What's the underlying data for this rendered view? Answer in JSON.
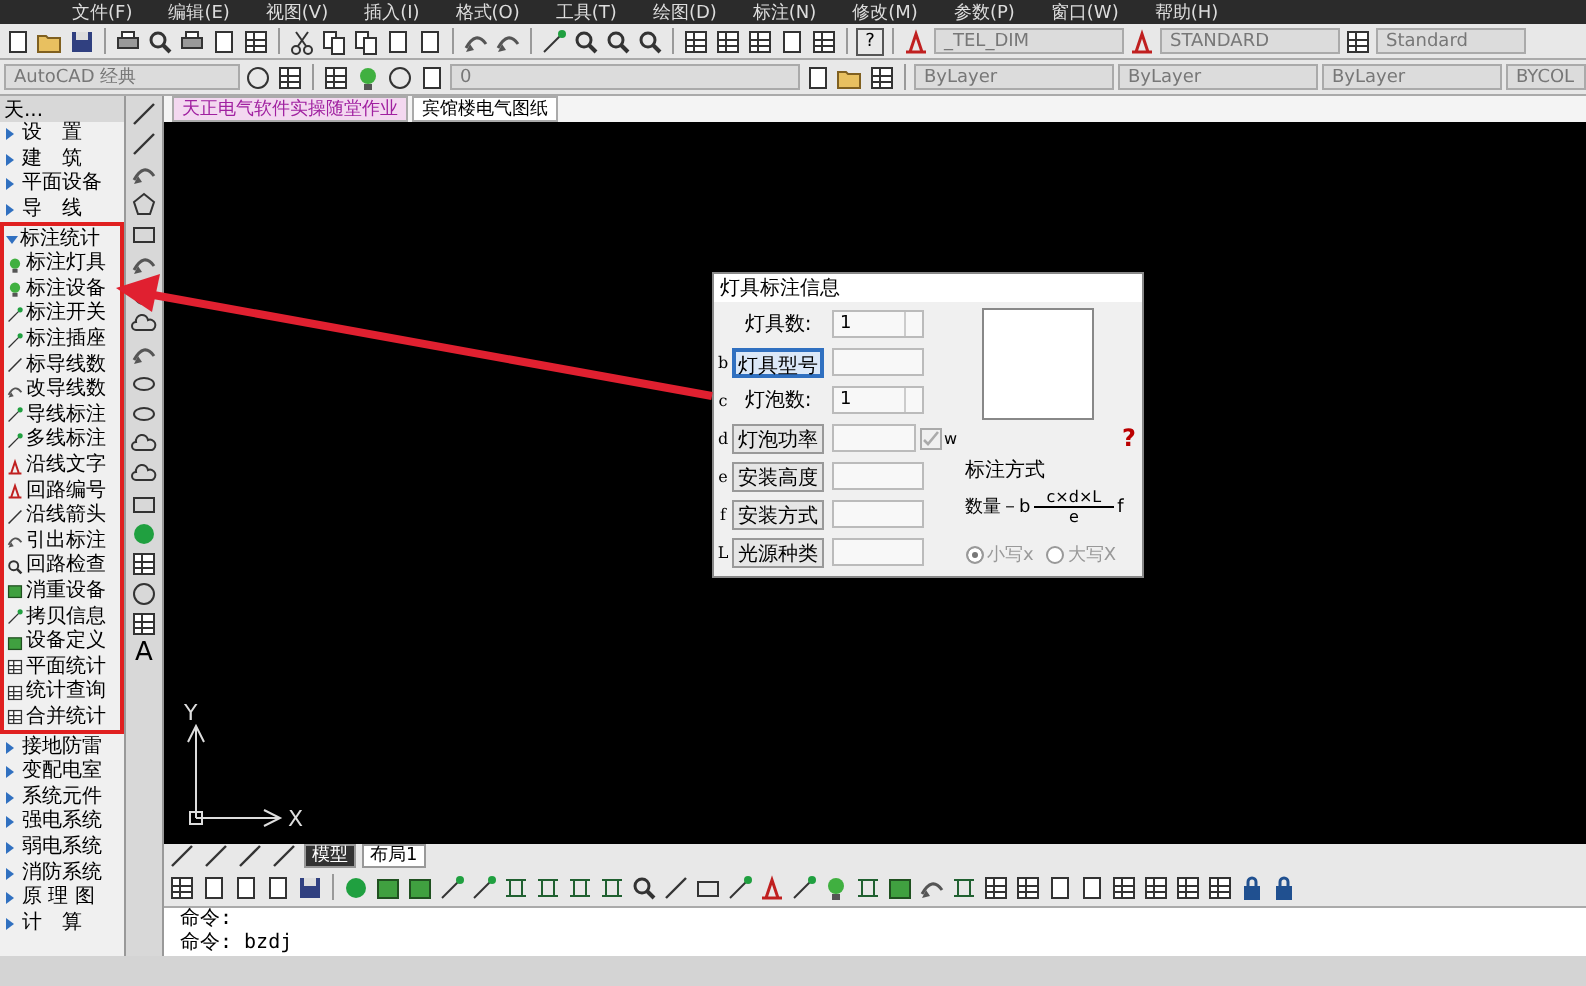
{
  "menu_bar": [
    "文件(F)",
    "编辑(E)",
    "视图(V)",
    "插入(I)",
    "格式(O)",
    "工具(T)",
    "绘图(D)",
    "标注(N)",
    "修改(M)",
    "参数(P)",
    "窗口(W)",
    "帮助(H)"
  ],
  "toolbar": {
    "help_label": "?",
    "text_style": "_TEL_DIM",
    "dim_style": "STANDARD",
    "table_style": "Standard"
  },
  "properties_bar": {
    "workspace": "AutoCAD 经典",
    "layer": "0",
    "color_control": "ByLayer",
    "linetype": "ByLayer",
    "lineweight": "ByLayer",
    "plot_style": "BYCOL"
  },
  "document_tabs": [
    {
      "label": "天正电气软件实操随堂作业",
      "selected": true
    },
    {
      "label": "宾馆楼电气图纸",
      "selected": false
    }
  ],
  "sidebar": {
    "title": "天...",
    "items": [
      {
        "label": "设　置",
        "expanded": false
      },
      {
        "label": "建　筑",
        "expanded": false
      },
      {
        "label": "平面设备",
        "expanded": false
      },
      {
        "label": "导　线",
        "expanded": false
      },
      {
        "label": "标注统计",
        "expanded": true,
        "children": [
          "标注灯具",
          "标注设备",
          "标注开关",
          "标注插座",
          "标导线数",
          "改导线数",
          "导线标注",
          "多线标注",
          "沿线文字",
          "回路编号",
          "沿线箭头",
          "引出标注",
          "回路检查",
          "消重设备",
          "拷贝信息",
          "设备定义",
          "平面统计",
          "统计查询",
          "合并统计"
        ]
      },
      {
        "label": "接地防雷",
        "expanded": false
      },
      {
        "label": "变配电室",
        "expanded": false
      },
      {
        "label": "系统元件",
        "expanded": false
      },
      {
        "label": "强电系统",
        "expanded": false
      },
      {
        "label": "弱电系统",
        "expanded": false
      },
      {
        "label": "消防系统",
        "expanded": false
      },
      {
        "label": "原 理 图",
        "expanded": false
      },
      {
        "label": "计　算",
        "expanded": false
      }
    ]
  },
  "draw_toolbar": {
    "text_tool": "A"
  },
  "dialog": {
    "title": "灯具标注信息",
    "rows": [
      {
        "letter": "",
        "kind": "label",
        "label": "灯具数:",
        "value": "1",
        "spinner": true,
        "focused": false
      },
      {
        "letter": "b",
        "kind": "button",
        "label": "灯具型号",
        "value": "",
        "spinner": false,
        "focused": true
      },
      {
        "letter": "c",
        "kind": "label",
        "label": "灯泡数:",
        "value": "1",
        "spinner": true,
        "focused": false
      },
      {
        "letter": "d",
        "kind": "button",
        "label": "灯泡功率",
        "value": "",
        "spinner": false,
        "focused": false,
        "checkbox": {
          "checked": true,
          "label": "w"
        }
      },
      {
        "letter": "e",
        "kind": "button",
        "label": "安装高度",
        "value": "",
        "spinner": false,
        "focused": false
      },
      {
        "letter": "f",
        "kind": "button",
        "label": "安装方式",
        "value": "",
        "spinner": false,
        "focused": false
      },
      {
        "letter": "L",
        "kind": "button",
        "label": "光源种类",
        "value": "",
        "spinner": false,
        "focused": false
      }
    ],
    "help": "?",
    "mode_title": "标注方式",
    "formula": {
      "prefix": "数量－b",
      "numerator": "c×d×L",
      "denominator": "e",
      "suffix": "f"
    },
    "radios_disabled": true,
    "radios": [
      {
        "label": "小写x",
        "selected": true
      },
      {
        "label": "大写X",
        "selected": false
      }
    ]
  },
  "ucs": {
    "y": "Y",
    "x": "X"
  },
  "layout_tabs": [
    {
      "label": "模型",
      "selected": true
    },
    {
      "label": "布局1",
      "selected": false
    }
  ],
  "command_lines": [
    "命令:",
    "命令: bzdj"
  ]
}
